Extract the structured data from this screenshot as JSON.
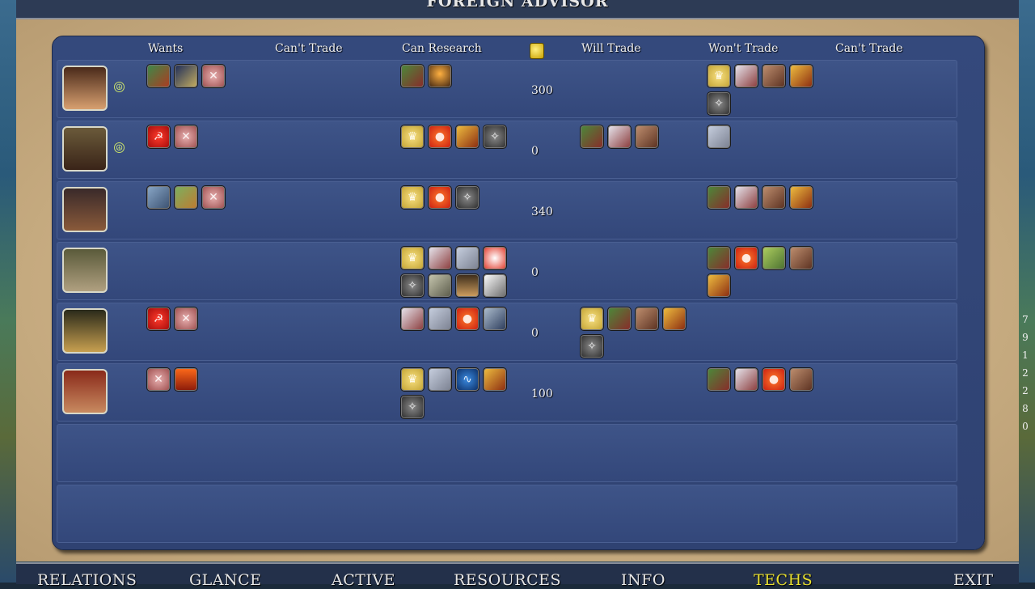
{
  "title": "FOREIGN ADVISOR",
  "headers": {
    "wants": "Wants",
    "cant_trade_1": "Can't Trade",
    "can_research": "Can Research",
    "will_trade": "Will Trade",
    "wont_trade": "Won't Trade",
    "cant_trade_2": "Can't Trade"
  },
  "gold_header_icon": "gold-coin-icon",
  "rows": [
    {
      "leader": "leader-1",
      "peace": true,
      "gold": "300",
      "wants": [
        "apple-tech",
        "swirl-tech",
        "pink-tech"
      ],
      "can_research": [
        "flag-tech",
        "candle-tech"
      ],
      "will_trade": [],
      "wont_trade": [
        "crown-tech",
        "parchment-tech",
        "arrow-tech",
        "horn-tech",
        "wheel-tech"
      ]
    },
    {
      "leader": "leader-2",
      "peace": true,
      "gold": "0",
      "wants": [
        "hammer-tech",
        "pink-tech"
      ],
      "can_research": [
        "crown-tech",
        "red-tech",
        "horn-tech",
        "wheel-tech"
      ],
      "will_trade": [
        "flag-tech",
        "parchment-tech",
        "arrow-tech"
      ],
      "wont_trade": [
        "compass-tech"
      ]
    },
    {
      "leader": "leader-3",
      "peace": false,
      "gold": "340",
      "wants": [
        "statue-tech",
        "map-tech",
        "pink-tech"
      ],
      "can_research": [
        "crown-tech",
        "red-tech",
        "wheel-tech"
      ],
      "will_trade": [],
      "wont_trade": [
        "flag-tech",
        "parchment-tech",
        "arrow-tech",
        "horn-tech"
      ]
    },
    {
      "leader": "leader-4",
      "peace": false,
      "gold": "0",
      "wants": [],
      "can_research": [
        "crown-tech",
        "parchment-tech",
        "compass-tech",
        "orb-tech",
        "wheel-tech",
        "ship-tech",
        "train-tech",
        "silverblock-tech"
      ],
      "will_trade": [],
      "wont_trade": [
        "flag-tech",
        "red-tech",
        "greenp-tech",
        "arrow-tech",
        "horn-tech"
      ]
    },
    {
      "leader": "leader-5",
      "peace": false,
      "gold": "0",
      "wants": [
        "hammer-tech",
        "pink-tech"
      ],
      "can_research": [
        "parchment-tech",
        "compass-tech",
        "red-tech",
        "factory-tech"
      ],
      "will_trade": [
        "crown-tech",
        "flag-tech",
        "arrow-tech",
        "horn-tech",
        "wheel-tech"
      ],
      "wont_trade": []
    },
    {
      "leader": "leader-6",
      "peace": false,
      "gold": "100",
      "wants": [
        "pink-tech",
        "lava-tech"
      ],
      "can_research": [
        "crown-tech",
        "compass-tech",
        "swirl2-tech",
        "horn-tech",
        "wheel-tech"
      ],
      "will_trade": [],
      "wont_trade": [
        "flag-tech",
        "parchment-tech",
        "red-tech",
        "arrow-tech"
      ]
    }
  ],
  "bottom_tabs": [
    "RELATIONS",
    "GLANCE",
    "ACTIVE",
    "RESOURCES",
    "INFO",
    "TECHS",
    "EXIT"
  ],
  "active_tab": "TECHS",
  "right_numbers": [
    "7",
    "9",
    "1",
    "2",
    "2",
    "8",
    "0"
  ]
}
